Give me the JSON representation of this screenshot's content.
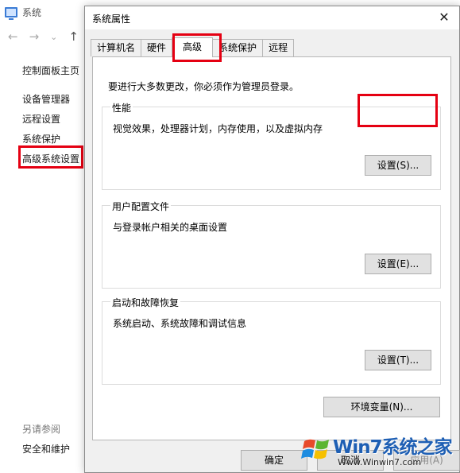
{
  "background": {
    "title": "系统",
    "nav": {
      "back": "←",
      "forward": "→",
      "dropdown": "⌄",
      "up": "↑"
    },
    "links": {
      "home": "控制面板主页",
      "device_manager": "设备管理器",
      "remote": "远程设置",
      "protection": "系统保护",
      "advanced": "高级系统设置"
    },
    "see_also": "另请参阅",
    "security": "安全和维护"
  },
  "dialog": {
    "title": "系统属性",
    "close": "✕",
    "tabs": [
      {
        "label": "计算机名"
      },
      {
        "label": "硬件"
      },
      {
        "label": "高级"
      },
      {
        "label": "系统保护"
      },
      {
        "label": "远程"
      }
    ],
    "active_tab": "高级",
    "admin_note": "要进行大多数更改，你必须作为管理员登录。",
    "performance": {
      "title": "性能",
      "desc": "视觉效果，处理器计划，内存使用，以及虚拟内存",
      "button": "设置(S)..."
    },
    "profile": {
      "title": "用户配置文件",
      "desc": "与登录帐户相关的桌面设置",
      "button": "设置(E)..."
    },
    "startup": {
      "title": "启动和故障恢复",
      "desc": "系统启动、系统故障和调试信息",
      "button": "设置(T)..."
    },
    "env_button": "环境变量(N)...",
    "ok": "确定",
    "cancel": "取消",
    "apply": "应用(A)"
  },
  "watermark": {
    "text": "Win7系统之家",
    "url": "Www.Winwin7.com"
  },
  "colors": {
    "highlight": "#e50012",
    "watermark_blue": "#1e5fb4"
  }
}
